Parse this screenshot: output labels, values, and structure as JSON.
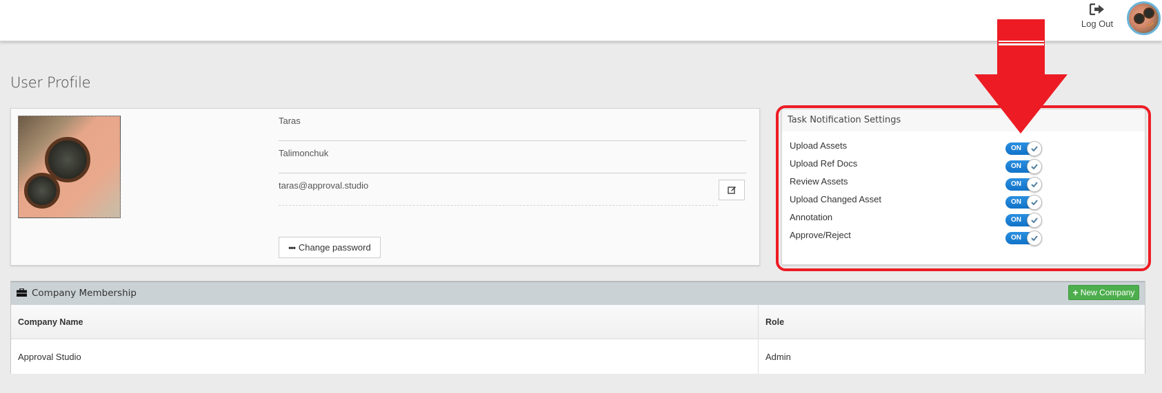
{
  "header": {
    "logout_label": "Log Out",
    "logout_icon": "sign-out-icon",
    "avatar_icon": "user-avatar"
  },
  "page_title": "User Profile",
  "profile": {
    "first_name": "Taras",
    "last_name": "Talimonchuk",
    "email": "taras@approval.studio",
    "edit_icon": "edit-icon",
    "change_password_label": "Change password",
    "change_password_icon": "ellipsis-icon"
  },
  "notifications": {
    "title": "Task Notification Settings",
    "toggle_on_label": "ON",
    "items": [
      {
        "label": "Upload Assets",
        "state": "on"
      },
      {
        "label": "Upload Ref Docs",
        "state": "on"
      },
      {
        "label": "Review Assets",
        "state": "on"
      },
      {
        "label": "Upload Changed Asset",
        "state": "on"
      },
      {
        "label": "Annotation",
        "state": "on"
      },
      {
        "label": "Approve/Reject",
        "state": "on"
      }
    ]
  },
  "annotation": {
    "highlight_color": "#ed1c24"
  },
  "company": {
    "title": "Company Membership",
    "icon": "briefcase-icon",
    "new_button_label": "New Company",
    "columns": [
      "Company Name",
      "Role"
    ],
    "rows": [
      {
        "name": "Approval Studio",
        "role": "Admin"
      }
    ]
  },
  "colors": {
    "toggle_on": "#1a7fd4",
    "new_button": "#4cae4c",
    "section_header": "#cbd2d6",
    "avatar_border": "#6ab4d8"
  }
}
